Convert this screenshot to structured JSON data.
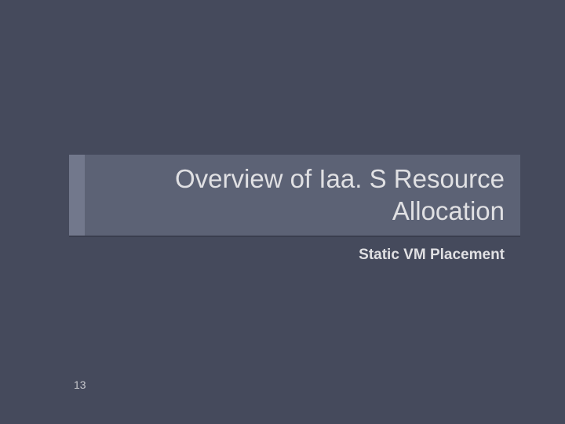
{
  "slide": {
    "title": "Overview of Iaa. S Resource Allocation",
    "subtitle": "Static VM Placement",
    "page_number": "13"
  }
}
